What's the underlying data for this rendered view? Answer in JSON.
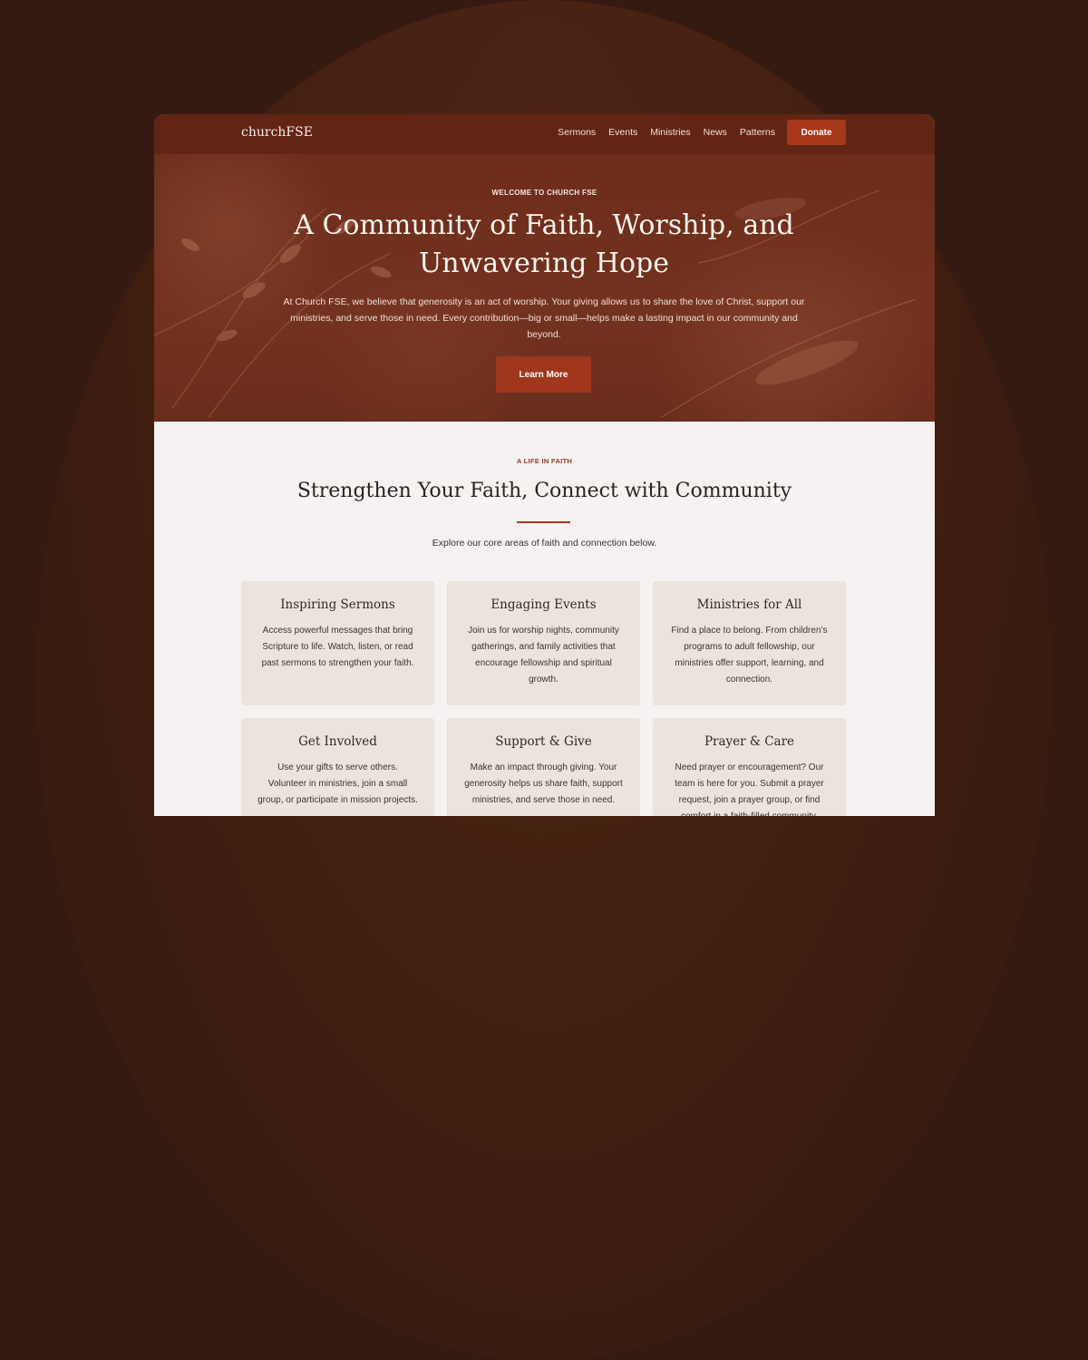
{
  "header": {
    "logo": "churchFSE",
    "nav": [
      "Sermons",
      "Events",
      "Ministries",
      "News",
      "Patterns"
    ],
    "donate_label": "Donate"
  },
  "hero": {
    "eyebrow": "WELCOME TO CHURCH FSE",
    "title": "A Community of Faith, Worship, and Unwavering Hope",
    "body": "At Church FSE, we believe that generosity is an act of worship. Your giving allows us to share the love of Christ, support our ministries, and serve those in need. Every contribution—big or small—helps make a lasting impact in our community and beyond.",
    "cta_label": "Learn More"
  },
  "section": {
    "eyebrow": "A LIFE IN FAITH",
    "title": "Strengthen Your Faith, Connect with Community",
    "subtitle": "Explore our core areas of faith and connection below.",
    "cards": [
      {
        "title": "Inspiring Sermons",
        "text": "Access powerful messages that bring Scripture to life. Watch, listen, or read past sermons to strengthen your faith."
      },
      {
        "title": "Engaging Events",
        "text": "Join us for worship nights, community gatherings, and family activities that encourage fellowship and spiritual growth."
      },
      {
        "title": "Ministries for All",
        "text": "Find a place to belong. From children’s programs to adult fellowship, our ministries offer support, learning, and connection."
      },
      {
        "title": "Get Involved",
        "text": "Use your gifts to serve others. Volunteer in ministries, join a small group, or participate in mission projects."
      },
      {
        "title": "Support & Give",
        "text": "Make an impact through giving. Your generosity helps us share faith, support ministries, and serve those in need."
      },
      {
        "title": "Prayer & Care",
        "text": "Need prayer or encouragement? Our team is here for you. Submit a prayer request, join a prayer group, or find comfort in a faith-filled community."
      }
    ]
  },
  "colors": {
    "background": "#351a11",
    "header": "#612515",
    "accent": "#a8381c",
    "card": "#ebe4de"
  }
}
